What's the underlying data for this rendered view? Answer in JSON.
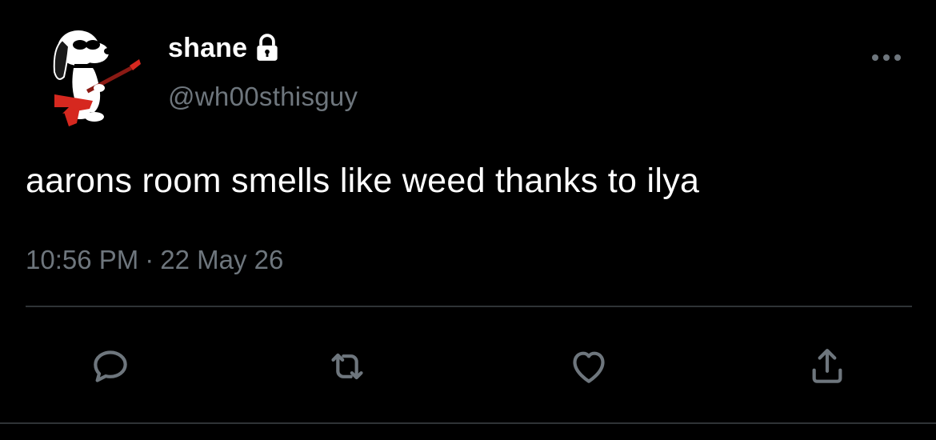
{
  "user": {
    "display_name": "shane",
    "handle": "@wh00sthisguy",
    "protected": true
  },
  "tweet": {
    "text": "aarons room smells like weed thanks to ilya",
    "time": "10:56 PM",
    "separator": "·",
    "date": "22 May 26"
  },
  "actions": {
    "reply_icon": "reply-icon",
    "retweet_icon": "retweet-icon",
    "like_icon": "heart-icon",
    "share_icon": "share-icon"
  },
  "colors": {
    "background": "#000000",
    "text_primary": "#ffffff",
    "text_secondary": "#6e767d",
    "divider": "#2f3336",
    "guitar_red": "#d6281f"
  }
}
